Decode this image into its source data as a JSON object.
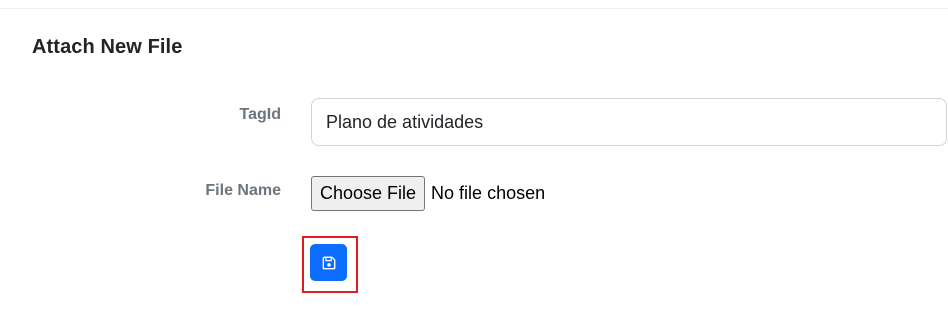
{
  "form": {
    "title": "Attach New File",
    "tagid": {
      "label": "TagId",
      "value": "Plano de atividades"
    },
    "file_name": {
      "label": "File Name",
      "button_label": "Choose File",
      "status": "No file chosen"
    },
    "save": {
      "icon": "floppy-disk-icon",
      "color": "#0d6efd",
      "highlight_color": "#e11d21"
    }
  }
}
